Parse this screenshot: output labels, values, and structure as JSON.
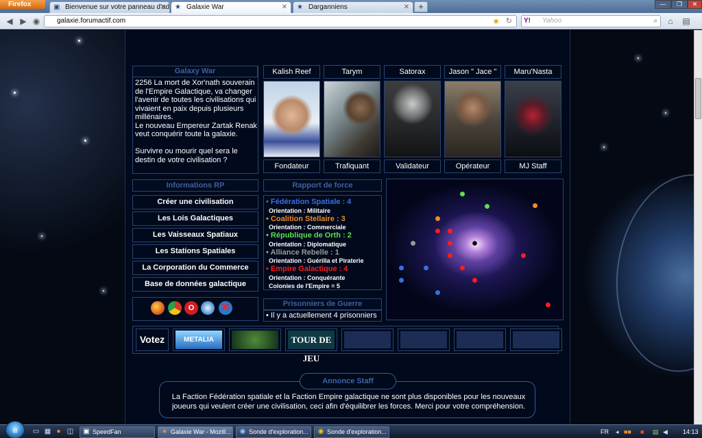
{
  "browser": {
    "menu_label": "Firefox",
    "tabs": [
      {
        "title": "Bienvenue sur votre panneau d'adm...",
        "active": false,
        "icon": "forum-icon"
      },
      {
        "title": "Galaxie War",
        "active": true,
        "icon": "star-icon"
      },
      {
        "title": "Darganniens",
        "active": false,
        "icon": "star-icon"
      }
    ],
    "new_tab_label": "+",
    "url_host": "galaxie.forumactif.com",
    "search_placeholder": "Yahoo",
    "search_brand": "Y!"
  },
  "intro": {
    "title": "Galaxy War",
    "text": "2256 La mort de Xor'nath souverain de l'Empire Galactique, va changer l'avenir de toutes les civilisations qui vivaient en paix depuis plusieurs millénaires.\nLe nouveau Empereur Zartak Renak veut conquérir toute la galaxie.\n\nSurvivre ou mourir quel sera le destin de votre civilisation ?"
  },
  "staff": [
    {
      "name": "Kalish Reef",
      "role": "Fondateur",
      "portrait": "armored-soldier-portrait"
    },
    {
      "name": "Tarym",
      "role": "Trafiquant",
      "portrait": "gunman-portrait"
    },
    {
      "name": "Satorax",
      "role": "Validateur",
      "portrait": "helmeted-trooper-portrait"
    },
    {
      "name": "Jason \" Jace \"",
      "role": "Opérateur",
      "portrait": "marine-portrait"
    },
    {
      "name": "Maru'Nasta",
      "role": "MJ Staff",
      "portrait": "hooded-figure-portrait"
    }
  ],
  "info_rp": {
    "title": "Informations RP",
    "links": [
      "Créer une civilisation",
      "Les Lois Galactiques",
      "Les Vaisseaux Spatiaux",
      "Les Stations Spatiales",
      "La Corporation du Commerce",
      "Base de données galactique"
    ]
  },
  "rapport": {
    "title": "Rapport de force",
    "factions": [
      {
        "name": "Fédération Spatiale : 4",
        "color": "#3b6fe0",
        "lines": [
          "Orientation : Militaire"
        ]
      },
      {
        "name": "Coalition Stellaire : 3",
        "color": "#f08a24",
        "lines": [
          "Orientation : Commerciale"
        ]
      },
      {
        "name": "République de Orth : 2",
        "color": "#5ee04a",
        "lines": [
          "Orientation : Diplomatique"
        ]
      },
      {
        "name": "Alliance Rebelle : 1",
        "color": "#9a9a9a",
        "lines": [
          "Orientation : Guérilla et Piraterie"
        ]
      },
      {
        "name": "Empire Galactique : 4",
        "color": "#ff1c1c",
        "lines": [
          "Orientation : Conquérante",
          "Colonies de l'Empire = 5"
        ]
      }
    ]
  },
  "galaxy_map": {
    "image": "spiral-galaxy-map"
  },
  "browsers": [
    "firefox-icon",
    "chrome-icon",
    "opera-icon",
    "safari-icon",
    "ie-icon"
  ],
  "prisoners": {
    "title": "Prisonniers de Guerre",
    "text": "• Il y a actuellement 4 prisonniers"
  },
  "vote": {
    "label": "Votez",
    "banners": [
      "METALIA",
      "",
      "TOUR DE JEU"
    ]
  },
  "annonce": {
    "title": "Annonce Staff",
    "text": "La Faction Fédération spatiale et la Faction Empire galactique ne sont plus disponibles pour les nouveaux joueurs qui veulent créer une civilisation, ceci afin d'équilibrer les forces. Merci pour votre compréhension."
  },
  "taskbar": {
    "items": [
      {
        "label": "SpeedFan",
        "icon": "speedfan-icon"
      },
      {
        "label": "Galaxie War - Mozill...",
        "icon": "firefox-icon"
      },
      {
        "label": "Sonde d'exploration...",
        "icon": "sonde-icon"
      },
      {
        "label": "Sonde d'exploration...",
        "icon": "chrome-icon"
      }
    ],
    "lang": "FR",
    "clock": "14:13"
  }
}
